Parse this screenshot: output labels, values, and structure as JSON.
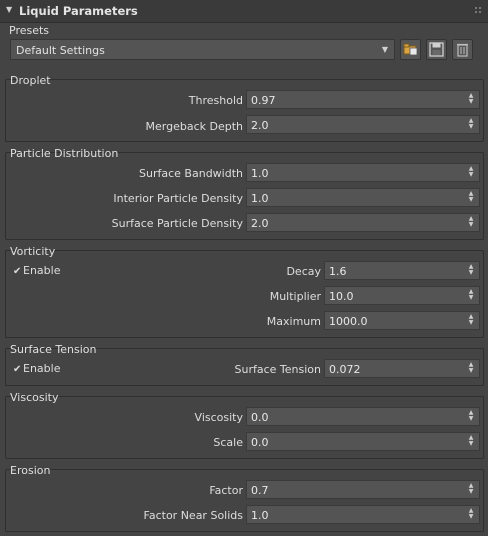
{
  "rollout": {
    "title": "Liquid Parameters"
  },
  "presets": {
    "label": "Presets",
    "selected": "Default Settings",
    "icons": [
      "load-preset-icon",
      "save-preset-icon",
      "delete-preset-icon"
    ]
  },
  "droplet": {
    "title": "Droplet",
    "threshold_label": "Threshold",
    "threshold_value": "0.97",
    "mergeback_label": "Mergeback Depth",
    "mergeback_value": "2.0"
  },
  "particle_distribution": {
    "title": "Particle Distribution",
    "bandwidth_label": "Surface Bandwidth",
    "bandwidth_value": "1.0",
    "interior_label": "Interior Particle Density",
    "interior_value": "1.0",
    "surface_label": "Surface Particle Density",
    "surface_value": "2.0"
  },
  "vorticity": {
    "title": "Vorticity",
    "enable_label": "Enable",
    "enabled": true,
    "decay_label": "Decay",
    "decay_value": "1.6",
    "multiplier_label": "Multiplier",
    "multiplier_value": "10.0",
    "maximum_label": "Maximum",
    "maximum_value": "1000.0"
  },
  "surface_tension": {
    "title": "Surface Tension",
    "enable_label": "Enable",
    "enabled": true,
    "tension_label": "Surface Tension",
    "tension_value": "0.072"
  },
  "viscosity": {
    "title": "Viscosity",
    "viscosity_label": "Viscosity",
    "viscosity_value": "0.0",
    "scale_label": "Scale",
    "scale_value": "0.0"
  },
  "erosion": {
    "title": "Erosion",
    "factor_label": "Factor",
    "factor_value": "0.7",
    "near_solids_label": "Factor Near Solids",
    "near_solids_value": "1.0"
  },
  "colors": {
    "panel_bg": "#444444",
    "field_bg": "#545454",
    "border": "#2f2f2f",
    "text": "#dedede"
  }
}
